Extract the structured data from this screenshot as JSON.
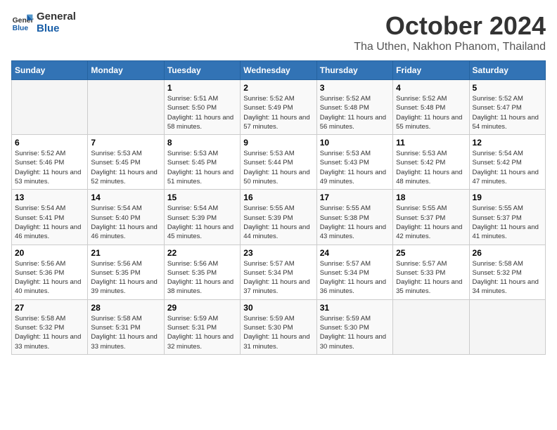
{
  "header": {
    "logo_line1": "General",
    "logo_line2": "Blue",
    "title": "October 2024",
    "subtitle": "Tha Uthen, Nakhon Phanom, Thailand"
  },
  "weekdays": [
    "Sunday",
    "Monday",
    "Tuesday",
    "Wednesday",
    "Thursday",
    "Friday",
    "Saturday"
  ],
  "weeks": [
    [
      {
        "day": "",
        "info": ""
      },
      {
        "day": "",
        "info": ""
      },
      {
        "day": "1",
        "info": "Sunrise: 5:51 AM\nSunset: 5:50 PM\nDaylight: 11 hours and 58 minutes."
      },
      {
        "day": "2",
        "info": "Sunrise: 5:52 AM\nSunset: 5:49 PM\nDaylight: 11 hours and 57 minutes."
      },
      {
        "day": "3",
        "info": "Sunrise: 5:52 AM\nSunset: 5:48 PM\nDaylight: 11 hours and 56 minutes."
      },
      {
        "day": "4",
        "info": "Sunrise: 5:52 AM\nSunset: 5:48 PM\nDaylight: 11 hours and 55 minutes."
      },
      {
        "day": "5",
        "info": "Sunrise: 5:52 AM\nSunset: 5:47 PM\nDaylight: 11 hours and 54 minutes."
      }
    ],
    [
      {
        "day": "6",
        "info": "Sunrise: 5:52 AM\nSunset: 5:46 PM\nDaylight: 11 hours and 53 minutes."
      },
      {
        "day": "7",
        "info": "Sunrise: 5:53 AM\nSunset: 5:45 PM\nDaylight: 11 hours and 52 minutes."
      },
      {
        "day": "8",
        "info": "Sunrise: 5:53 AM\nSunset: 5:45 PM\nDaylight: 11 hours and 51 minutes."
      },
      {
        "day": "9",
        "info": "Sunrise: 5:53 AM\nSunset: 5:44 PM\nDaylight: 11 hours and 50 minutes."
      },
      {
        "day": "10",
        "info": "Sunrise: 5:53 AM\nSunset: 5:43 PM\nDaylight: 11 hours and 49 minutes."
      },
      {
        "day": "11",
        "info": "Sunrise: 5:53 AM\nSunset: 5:42 PM\nDaylight: 11 hours and 48 minutes."
      },
      {
        "day": "12",
        "info": "Sunrise: 5:54 AM\nSunset: 5:42 PM\nDaylight: 11 hours and 47 minutes."
      }
    ],
    [
      {
        "day": "13",
        "info": "Sunrise: 5:54 AM\nSunset: 5:41 PM\nDaylight: 11 hours and 46 minutes."
      },
      {
        "day": "14",
        "info": "Sunrise: 5:54 AM\nSunset: 5:40 PM\nDaylight: 11 hours and 46 minutes."
      },
      {
        "day": "15",
        "info": "Sunrise: 5:54 AM\nSunset: 5:39 PM\nDaylight: 11 hours and 45 minutes."
      },
      {
        "day": "16",
        "info": "Sunrise: 5:55 AM\nSunset: 5:39 PM\nDaylight: 11 hours and 44 minutes."
      },
      {
        "day": "17",
        "info": "Sunrise: 5:55 AM\nSunset: 5:38 PM\nDaylight: 11 hours and 43 minutes."
      },
      {
        "day": "18",
        "info": "Sunrise: 5:55 AM\nSunset: 5:37 PM\nDaylight: 11 hours and 42 minutes."
      },
      {
        "day": "19",
        "info": "Sunrise: 5:55 AM\nSunset: 5:37 PM\nDaylight: 11 hours and 41 minutes."
      }
    ],
    [
      {
        "day": "20",
        "info": "Sunrise: 5:56 AM\nSunset: 5:36 PM\nDaylight: 11 hours and 40 minutes."
      },
      {
        "day": "21",
        "info": "Sunrise: 5:56 AM\nSunset: 5:35 PM\nDaylight: 11 hours and 39 minutes."
      },
      {
        "day": "22",
        "info": "Sunrise: 5:56 AM\nSunset: 5:35 PM\nDaylight: 11 hours and 38 minutes."
      },
      {
        "day": "23",
        "info": "Sunrise: 5:57 AM\nSunset: 5:34 PM\nDaylight: 11 hours and 37 minutes."
      },
      {
        "day": "24",
        "info": "Sunrise: 5:57 AM\nSunset: 5:34 PM\nDaylight: 11 hours and 36 minutes."
      },
      {
        "day": "25",
        "info": "Sunrise: 5:57 AM\nSunset: 5:33 PM\nDaylight: 11 hours and 35 minutes."
      },
      {
        "day": "26",
        "info": "Sunrise: 5:58 AM\nSunset: 5:32 PM\nDaylight: 11 hours and 34 minutes."
      }
    ],
    [
      {
        "day": "27",
        "info": "Sunrise: 5:58 AM\nSunset: 5:32 PM\nDaylight: 11 hours and 33 minutes."
      },
      {
        "day": "28",
        "info": "Sunrise: 5:58 AM\nSunset: 5:31 PM\nDaylight: 11 hours and 33 minutes."
      },
      {
        "day": "29",
        "info": "Sunrise: 5:59 AM\nSunset: 5:31 PM\nDaylight: 11 hours and 32 minutes."
      },
      {
        "day": "30",
        "info": "Sunrise: 5:59 AM\nSunset: 5:30 PM\nDaylight: 11 hours and 31 minutes."
      },
      {
        "day": "31",
        "info": "Sunrise: 5:59 AM\nSunset: 5:30 PM\nDaylight: 11 hours and 30 minutes."
      },
      {
        "day": "",
        "info": ""
      },
      {
        "day": "",
        "info": ""
      }
    ]
  ]
}
